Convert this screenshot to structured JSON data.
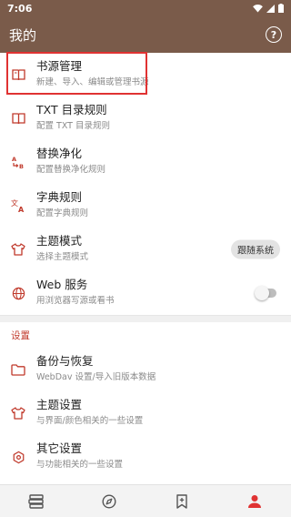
{
  "status_bar": {
    "time": "7:06"
  },
  "app_bar": {
    "title": "我的",
    "help_icon": "help-circle-icon"
  },
  "colors": {
    "primary": "#7a5b4a",
    "accent": "#e03232"
  },
  "main_items": [
    {
      "title": "书源管理",
      "subtitle": "新建、导入、编辑或管理书源",
      "icon": "book-icon"
    },
    {
      "title": "TXT 目录规则",
      "subtitle": "配置 TXT 目录规则",
      "icon": "book-open-icon"
    },
    {
      "title": "替换净化",
      "subtitle": "配置替换净化规则",
      "icon": "replace-icon"
    },
    {
      "title": "字典规则",
      "subtitle": "配置字典规则",
      "icon": "translate-icon"
    },
    {
      "title": "主题模式",
      "subtitle": "选择主题模式",
      "icon": "shirt-icon",
      "chip": "跟随系统"
    },
    {
      "title": "Web 服务",
      "subtitle": "用浏览器写源或看书",
      "icon": "globe-icon",
      "toggle": false
    }
  ],
  "settings_section": {
    "header": "设置",
    "items": [
      {
        "title": "备份与恢复",
        "subtitle": "WebDav 设置/导入旧版本数据",
        "icon": "folder-icon"
      },
      {
        "title": "主题设置",
        "subtitle": "与界面/颜色相关的一些设置",
        "icon": "shirt-icon"
      },
      {
        "title": "其它设置",
        "subtitle": "与功能相关的一些设置",
        "icon": "gear-icon"
      }
    ]
  },
  "bottom_nav": [
    {
      "name": "bookshelf",
      "icon": "bookshelf-icon",
      "active": false
    },
    {
      "name": "discover",
      "icon": "compass-icon",
      "active": false
    },
    {
      "name": "rss",
      "icon": "bookmark-icon",
      "active": false
    },
    {
      "name": "my",
      "icon": "person-icon",
      "active": true
    }
  ]
}
